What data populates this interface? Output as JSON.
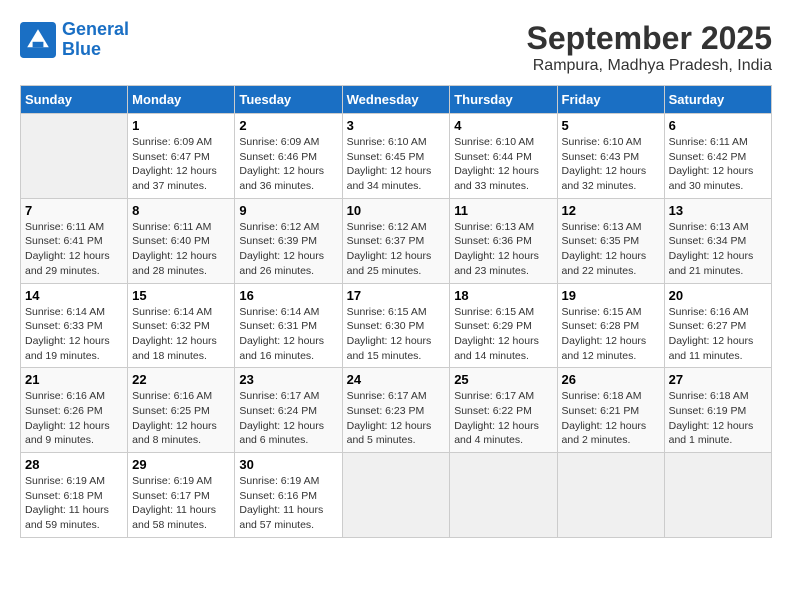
{
  "logo": {
    "line1": "General",
    "line2": "Blue"
  },
  "title": "September 2025",
  "location": "Rampura, Madhya Pradesh, India",
  "days_of_week": [
    "Sunday",
    "Monday",
    "Tuesday",
    "Wednesday",
    "Thursday",
    "Friday",
    "Saturday"
  ],
  "weeks": [
    [
      {
        "day": "",
        "info": ""
      },
      {
        "day": "1",
        "info": "Sunrise: 6:09 AM\nSunset: 6:47 PM\nDaylight: 12 hours\nand 37 minutes."
      },
      {
        "day": "2",
        "info": "Sunrise: 6:09 AM\nSunset: 6:46 PM\nDaylight: 12 hours\nand 36 minutes."
      },
      {
        "day": "3",
        "info": "Sunrise: 6:10 AM\nSunset: 6:45 PM\nDaylight: 12 hours\nand 34 minutes."
      },
      {
        "day": "4",
        "info": "Sunrise: 6:10 AM\nSunset: 6:44 PM\nDaylight: 12 hours\nand 33 minutes."
      },
      {
        "day": "5",
        "info": "Sunrise: 6:10 AM\nSunset: 6:43 PM\nDaylight: 12 hours\nand 32 minutes."
      },
      {
        "day": "6",
        "info": "Sunrise: 6:11 AM\nSunset: 6:42 PM\nDaylight: 12 hours\nand 30 minutes."
      }
    ],
    [
      {
        "day": "7",
        "info": "Sunrise: 6:11 AM\nSunset: 6:41 PM\nDaylight: 12 hours\nand 29 minutes."
      },
      {
        "day": "8",
        "info": "Sunrise: 6:11 AM\nSunset: 6:40 PM\nDaylight: 12 hours\nand 28 minutes."
      },
      {
        "day": "9",
        "info": "Sunrise: 6:12 AM\nSunset: 6:39 PM\nDaylight: 12 hours\nand 26 minutes."
      },
      {
        "day": "10",
        "info": "Sunrise: 6:12 AM\nSunset: 6:37 PM\nDaylight: 12 hours\nand 25 minutes."
      },
      {
        "day": "11",
        "info": "Sunrise: 6:13 AM\nSunset: 6:36 PM\nDaylight: 12 hours\nand 23 minutes."
      },
      {
        "day": "12",
        "info": "Sunrise: 6:13 AM\nSunset: 6:35 PM\nDaylight: 12 hours\nand 22 minutes."
      },
      {
        "day": "13",
        "info": "Sunrise: 6:13 AM\nSunset: 6:34 PM\nDaylight: 12 hours\nand 21 minutes."
      }
    ],
    [
      {
        "day": "14",
        "info": "Sunrise: 6:14 AM\nSunset: 6:33 PM\nDaylight: 12 hours\nand 19 minutes."
      },
      {
        "day": "15",
        "info": "Sunrise: 6:14 AM\nSunset: 6:32 PM\nDaylight: 12 hours\nand 18 minutes."
      },
      {
        "day": "16",
        "info": "Sunrise: 6:14 AM\nSunset: 6:31 PM\nDaylight: 12 hours\nand 16 minutes."
      },
      {
        "day": "17",
        "info": "Sunrise: 6:15 AM\nSunset: 6:30 PM\nDaylight: 12 hours\nand 15 minutes."
      },
      {
        "day": "18",
        "info": "Sunrise: 6:15 AM\nSunset: 6:29 PM\nDaylight: 12 hours\nand 14 minutes."
      },
      {
        "day": "19",
        "info": "Sunrise: 6:15 AM\nSunset: 6:28 PM\nDaylight: 12 hours\nand 12 minutes."
      },
      {
        "day": "20",
        "info": "Sunrise: 6:16 AM\nSunset: 6:27 PM\nDaylight: 12 hours\nand 11 minutes."
      }
    ],
    [
      {
        "day": "21",
        "info": "Sunrise: 6:16 AM\nSunset: 6:26 PM\nDaylight: 12 hours\nand 9 minutes."
      },
      {
        "day": "22",
        "info": "Sunrise: 6:16 AM\nSunset: 6:25 PM\nDaylight: 12 hours\nand 8 minutes."
      },
      {
        "day": "23",
        "info": "Sunrise: 6:17 AM\nSunset: 6:24 PM\nDaylight: 12 hours\nand 6 minutes."
      },
      {
        "day": "24",
        "info": "Sunrise: 6:17 AM\nSunset: 6:23 PM\nDaylight: 12 hours\nand 5 minutes."
      },
      {
        "day": "25",
        "info": "Sunrise: 6:17 AM\nSunset: 6:22 PM\nDaylight: 12 hours\nand 4 minutes."
      },
      {
        "day": "26",
        "info": "Sunrise: 6:18 AM\nSunset: 6:21 PM\nDaylight: 12 hours\nand 2 minutes."
      },
      {
        "day": "27",
        "info": "Sunrise: 6:18 AM\nSunset: 6:19 PM\nDaylight: 12 hours\nand 1 minute."
      }
    ],
    [
      {
        "day": "28",
        "info": "Sunrise: 6:19 AM\nSunset: 6:18 PM\nDaylight: 11 hours\nand 59 minutes."
      },
      {
        "day": "29",
        "info": "Sunrise: 6:19 AM\nSunset: 6:17 PM\nDaylight: 11 hours\nand 58 minutes."
      },
      {
        "day": "30",
        "info": "Sunrise: 6:19 AM\nSunset: 6:16 PM\nDaylight: 11 hours\nand 57 minutes."
      },
      {
        "day": "",
        "info": ""
      },
      {
        "day": "",
        "info": ""
      },
      {
        "day": "",
        "info": ""
      },
      {
        "day": "",
        "info": ""
      }
    ]
  ]
}
